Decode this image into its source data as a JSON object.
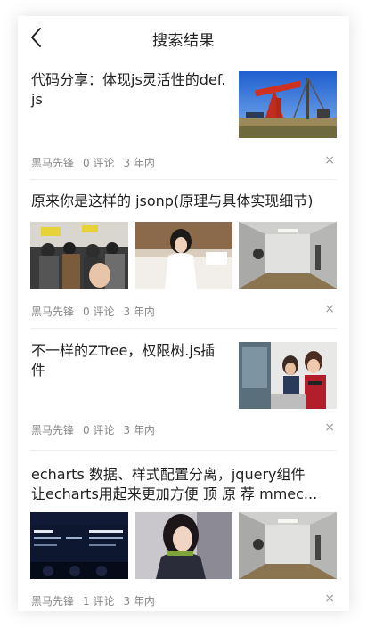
{
  "header": {
    "title": "搜索结果"
  },
  "articles": [
    {
      "title": "代码分享：体现js灵活性的def.js",
      "author": "黑马先锋",
      "comments": "0 评论",
      "time": "3 年内",
      "close": "×"
    },
    {
      "title": "原来你是这样的 jsonp(原理与具体实现细节)",
      "author": "黑马先锋",
      "comments": "0 评论",
      "time": "3 年内",
      "close": "×"
    },
    {
      "title": "不一样的ZTree，权限树.js插件",
      "author": "黑马先锋",
      "comments": "0 评论",
      "time": "3 年内",
      "close": "×"
    },
    {
      "title_line1": "echarts 数据、样式配置分离，jquery组件",
      "title_line2": "让echarts用起来更加方便 顶 原 荐 mmec...",
      "author": "黑马先锋",
      "comments": "1 评论",
      "time": "3 年内",
      "close": "×"
    }
  ]
}
